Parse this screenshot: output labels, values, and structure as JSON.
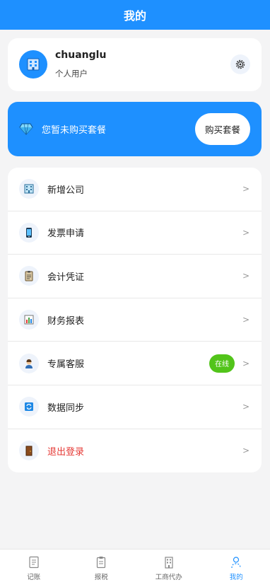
{
  "header": {
    "title": "我的"
  },
  "profile": {
    "name": "chuanglu",
    "type": "个人用户"
  },
  "plan": {
    "message": "您暂未购买套餐",
    "buy_label": "购买套餐"
  },
  "menu": {
    "items": [
      {
        "label": "新增公司",
        "icon": "building-icon"
      },
      {
        "label": "发票申请",
        "icon": "phone-icon"
      },
      {
        "label": "会计凭证",
        "icon": "clipboard-icon"
      },
      {
        "label": "财务报表",
        "icon": "bar-chart-icon"
      },
      {
        "label": "专属客服",
        "icon": "support-agent-icon",
        "badge": "在线"
      },
      {
        "label": "数据同步",
        "icon": "sync-icon"
      },
      {
        "label": "退出登录",
        "icon": "door-icon"
      }
    ],
    "chevron": ">"
  },
  "tabs": [
    {
      "label": "记账",
      "icon": "ledger-icon"
    },
    {
      "label": "报税",
      "icon": "clipboard-icon"
    },
    {
      "label": "工商代办",
      "icon": "building-icon"
    },
    {
      "label": "我的",
      "icon": "user-icon",
      "active": true
    }
  ],
  "colors": {
    "primary": "#1e90ff",
    "online": "#52c41a",
    "danger": "#e53935"
  }
}
